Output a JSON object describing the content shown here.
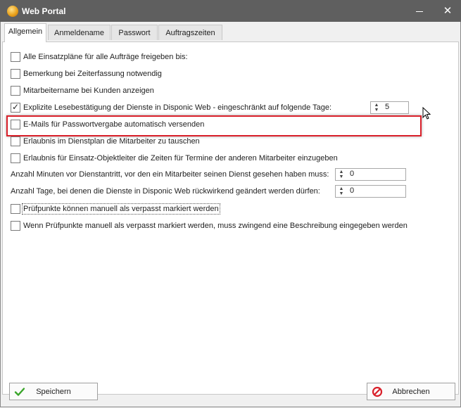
{
  "window": {
    "title": "Web Portal",
    "minimize_icon": "minimize-icon",
    "close_icon": "close-icon"
  },
  "tabs": [
    {
      "label": "Allgemein",
      "active": true
    },
    {
      "label": "Anmeldename",
      "active": false
    },
    {
      "label": "Passwort",
      "active": false
    },
    {
      "label": "Auftragszeiten",
      "active": false
    }
  ],
  "options": [
    {
      "label": "Alle Einsatzpläne für alle Aufträge freigeben bis:",
      "checked": false
    },
    {
      "label": "Bemerkung bei Zeiterfassung notwendig",
      "checked": false
    },
    {
      "label": "Mitarbeitername bei Kunden anzeigen",
      "checked": false
    },
    {
      "label": "Explizite Lesebestätigung der Dienste in Disponic Web - eingeschränkt auf folgende Tage:",
      "checked": true,
      "value": "5"
    },
    {
      "label": "E-Mails für Passwortvergabe automatisch versenden",
      "checked": false
    },
    {
      "label": "Erlaubnis im Dienstplan die Mitarbeiter zu tauschen",
      "checked": false
    },
    {
      "label": "Erlaubnis für  Einsatz-Objektleiter die Zeiten für Termine der anderen Mitarbeiter einzugeben",
      "checked": false
    }
  ],
  "fields": [
    {
      "label": "Anzahl Minuten vor Dienstantritt,  vor den ein Mitarbeiter seinen Dienst gesehen haben muss:",
      "value": "0"
    },
    {
      "label": "Anzahl Tage, bei denen die Dienste in Disponic Web rückwirkend geändert werden dürfen:",
      "value": "0"
    }
  ],
  "options2": [
    {
      "label": "Prüfpunkte können manuell als verpasst markiert werden",
      "checked": false
    },
    {
      "label": "Wenn Prüfpunkte manuell als verpasst markiert werden, muss zwingend eine Beschreibung eingegeben werden",
      "checked": false
    }
  ],
  "buttons": {
    "save": "Speichern",
    "cancel": "Abbrechen"
  },
  "colors": {
    "highlight": "#d9202a",
    "titlebar": "#5f5f5f"
  }
}
